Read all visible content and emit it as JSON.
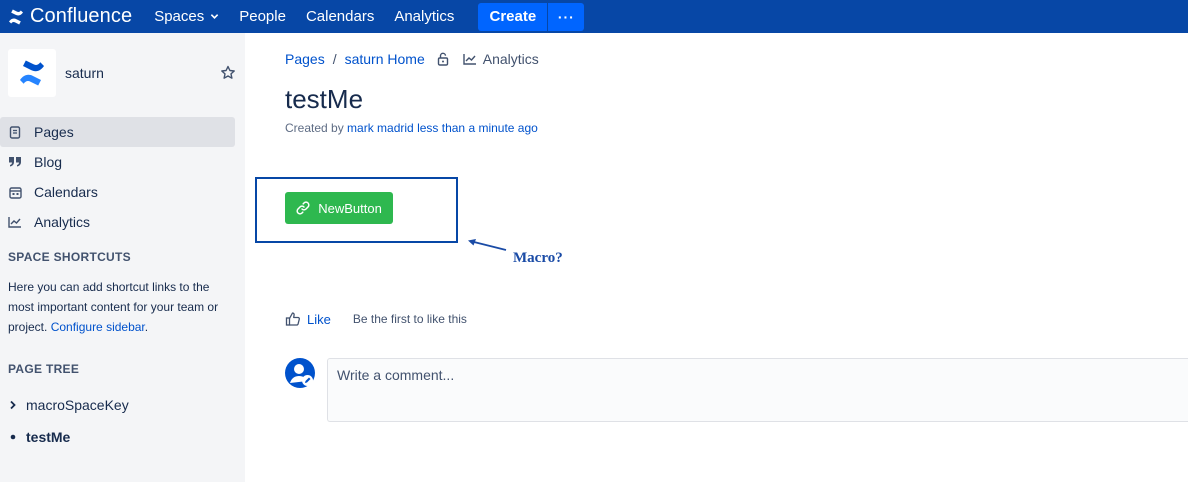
{
  "nav": {
    "brand": "Confluence",
    "links": [
      "Spaces",
      "People",
      "Calendars",
      "Analytics"
    ],
    "create_label": "Create",
    "more_label": "···"
  },
  "sidebar": {
    "space_name": "saturn",
    "items": [
      {
        "label": "Pages",
        "icon": "page-icon",
        "active": true
      },
      {
        "label": "Blog",
        "icon": "quote-icon",
        "active": false
      },
      {
        "label": "Calendars",
        "icon": "calendar-icon",
        "active": false
      },
      {
        "label": "Analytics",
        "icon": "analytics-icon",
        "active": false
      }
    ],
    "shortcuts_title": "SPACE SHORTCUTS",
    "shortcuts_text": "Here you can add shortcut links to the most important content for your team or project.",
    "configure_link": "Configure sidebar",
    "configure_suffix": ".",
    "page_tree_title": "PAGE TREE",
    "tree": [
      {
        "label": "macroSpaceKey",
        "marker": "chevron-right-icon"
      },
      {
        "label": "testMe",
        "marker": "bullet-icon"
      }
    ]
  },
  "breadcrumb": {
    "items": [
      "Pages",
      "saturn Home"
    ],
    "separator": "/",
    "analytics_label": "Analytics"
  },
  "page": {
    "title": "testMe",
    "byline_prefix": "Created by",
    "author": "mark madrid",
    "time": "less than a minute ago"
  },
  "macro": {
    "button_label": "NewButton",
    "annotation": "Macro?",
    "button_color": "#2eb84f",
    "box_color": "#0747a6"
  },
  "like": {
    "label": "Like",
    "note": "Be the first to like this"
  },
  "comment": {
    "placeholder": "Write a comment..."
  },
  "colors": {
    "nav_bg": "#0747a6",
    "create_bg": "#0065ff",
    "link": "#0052cc",
    "sidebar_bg": "#f4f5f7"
  }
}
